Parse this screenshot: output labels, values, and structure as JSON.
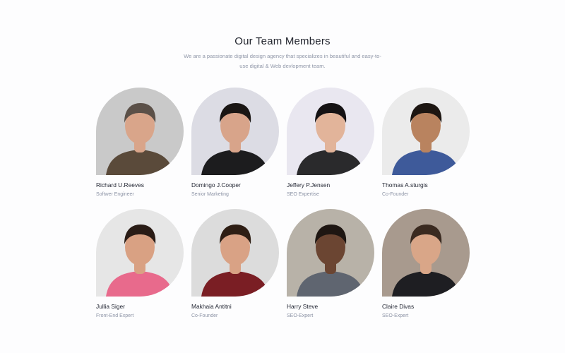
{
  "section": {
    "title": "Our Team Members",
    "subtitle": "We are a passionate digital design agency that specializes in beautiful and easy-to-use digital & Web devlopment team."
  },
  "members": [
    {
      "name": "Richard U.Reeves",
      "role": "Softwer Engineer",
      "bg": "#c9c9c9",
      "shirt": "#5a4a3a",
      "skin": "#d9a58a",
      "hair": "#5b5048"
    },
    {
      "name": "Domingo J.Cooper",
      "role": "Senior Marketing",
      "bg": "#dcdce4",
      "shirt": "#1c1c1e",
      "skin": "#d8a48a",
      "hair": "#1a1614"
    },
    {
      "name": "Jeffery P.Jensen",
      "role": "SEO Expertise",
      "bg": "#e9e7f0",
      "shirt": "#2a2a2c",
      "skin": "#e2b49a",
      "hair": "#151214"
    },
    {
      "name": "Thomas A.sturgis",
      "role": "Co-Founder",
      "bg": "#ebebeb",
      "shirt": "#3e5a9a",
      "skin": "#b9835f",
      "hair": "#1d1612"
    },
    {
      "name": "Jullia Siger",
      "role": "Front-End Expert",
      "bg": "#e6e6e6",
      "shirt": "#e86a8c",
      "skin": "#d9a183",
      "hair": "#2a1c16"
    },
    {
      "name": "Makhaia Antitni",
      "role": "Co-Founder",
      "bg": "#dcdcdc",
      "shirt": "#7a1e24",
      "skin": "#d9a285",
      "hair": "#2e1e14"
    },
    {
      "name": "Harry Steve",
      "role": "SEO-Expert",
      "bg": "#b8b2a8",
      "shirt": "#5f6570",
      "skin": "#6b4532",
      "hair": "#1e1612"
    },
    {
      "name": "Claire Divas",
      "role": "SEO-Expert",
      "bg": "#a89a8e",
      "shirt": "#1e1e22",
      "skin": "#d9a688",
      "hair": "#3a2a20"
    }
  ]
}
